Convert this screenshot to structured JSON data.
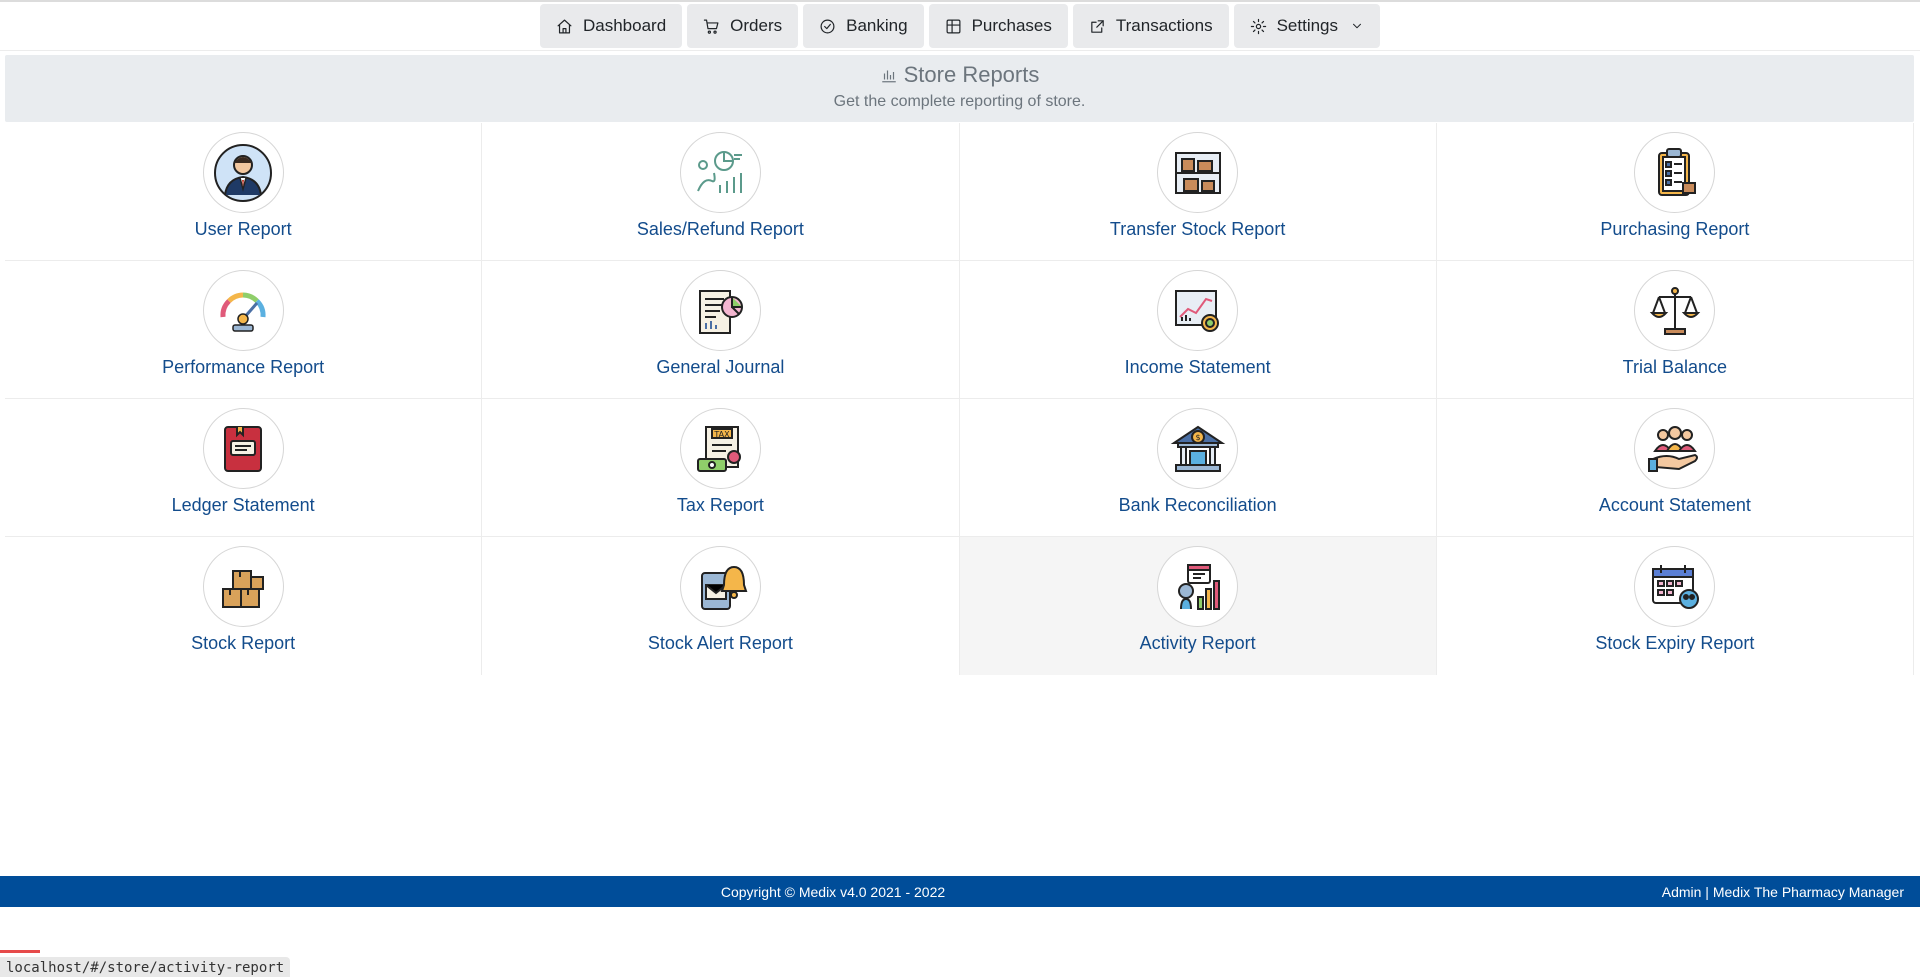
{
  "nav": {
    "items": [
      {
        "label": "Dashboard",
        "icon": "home-icon"
      },
      {
        "label": "Orders",
        "icon": "cart-icon"
      },
      {
        "label": "Banking",
        "icon": "check-circle-icon"
      },
      {
        "label": "Purchases",
        "icon": "table-icon"
      },
      {
        "label": "Transactions",
        "icon": "external-link-icon"
      },
      {
        "label": "Settings",
        "icon": "gear-icon"
      }
    ]
  },
  "banner": {
    "title": "Store Reports",
    "subtitle": "Get the complete reporting of store."
  },
  "reports": [
    {
      "label": "User Report",
      "icon": "user-icon"
    },
    {
      "label": "Sales/Refund Report",
      "icon": "sales-chart-icon"
    },
    {
      "label": "Transfer Stock Report",
      "icon": "shelf-boxes-icon"
    },
    {
      "label": "Purchasing Report",
      "icon": "clipboard-icon"
    },
    {
      "label": "Performance Report",
      "icon": "gauge-icon"
    },
    {
      "label": "General Journal",
      "icon": "journal-icon"
    },
    {
      "label": "Income Statement",
      "icon": "income-chart-icon"
    },
    {
      "label": "Trial Balance",
      "icon": "scales-icon"
    },
    {
      "label": "Ledger Statement",
      "icon": "ledger-book-icon"
    },
    {
      "label": "Tax Report",
      "icon": "tax-icon"
    },
    {
      "label": "Bank Reconciliation",
      "icon": "bank-icon"
    },
    {
      "label": "Account Statement",
      "icon": "people-hand-icon"
    },
    {
      "label": "Stock Report",
      "icon": "boxes-icon"
    },
    {
      "label": "Stock Alert Report",
      "icon": "bell-alert-icon"
    },
    {
      "label": "Activity Report",
      "icon": "activity-icon"
    },
    {
      "label": "Stock Expiry Report",
      "icon": "calendar-expiry-icon"
    }
  ],
  "active_report": "Activity Report",
  "footer": {
    "copyright": "Copyright © Medix v4.0 2021 - 2022",
    "right": "Admin | Medix The Pharmacy Manager"
  },
  "status_url": "localhost/#/store/activity-report",
  "colors": {
    "footer": "#004d99",
    "link": "#134c8c",
    "banner": "#e9ecef"
  }
}
